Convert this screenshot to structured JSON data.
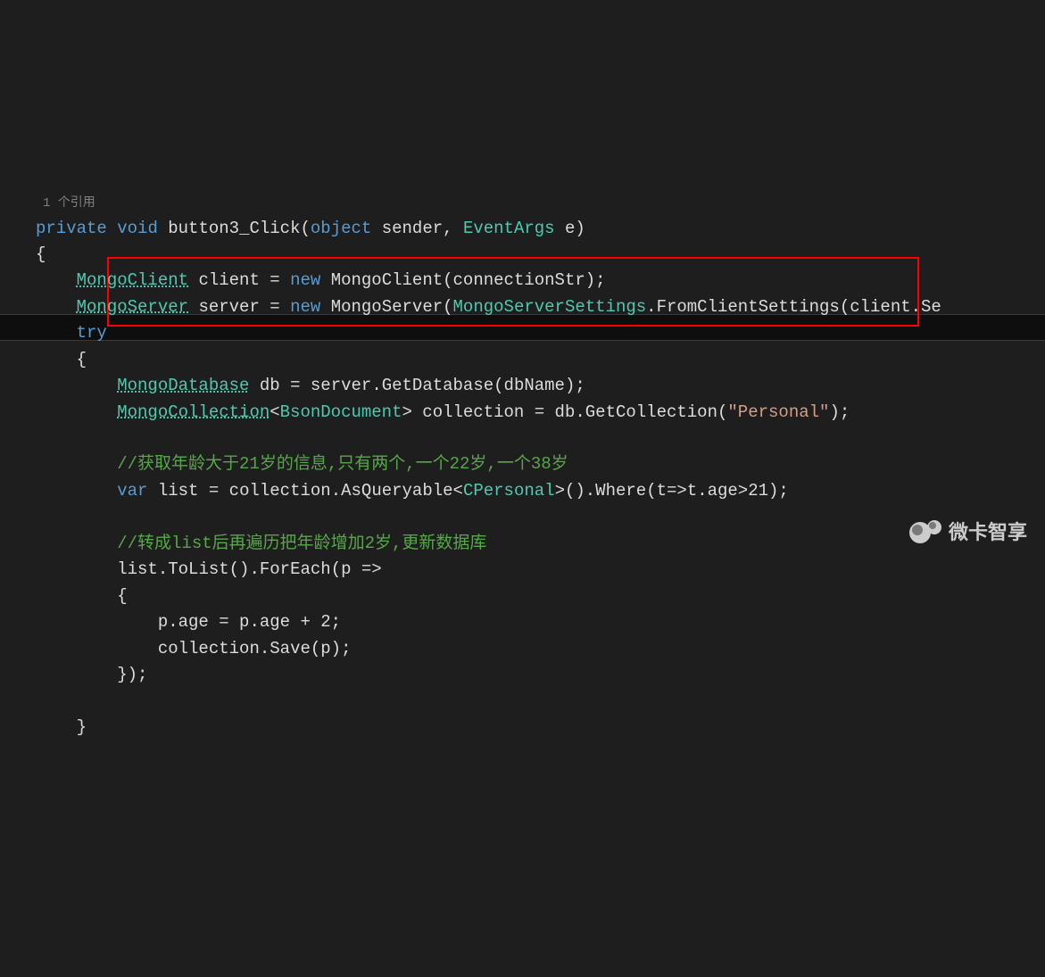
{
  "refs": "1 个引用",
  "code": {
    "kw_private": "private",
    "kw_void": "void",
    "method": "button3_Click",
    "kw_object": "object",
    "p_sender": "sender",
    "type_eventargs": "EventArgs",
    "p_e": "e",
    "type_mongoclient": "MongoClient",
    "v_client": "client",
    "kw_new1": "new",
    "ctor_mongoclient": "MongoClient",
    "p_conn": "connectionStr",
    "type_mongoserver": "MongoServer",
    "v_server": "server",
    "kw_new2": "new",
    "ctor_mongoserver": "MongoServer",
    "type_mss": "MongoServerSettings",
    "m_fromclient": "FromClientSettings",
    "p_clientSe": "client.Se",
    "kw_try": "try",
    "type_mongodb": "MongoDatabase",
    "v_db": "db",
    "v_server2": "server",
    "m_getdb": "GetDatabase",
    "p_dbname": "dbName",
    "type_mongocoll": "MongoCollection",
    "type_bsondoc": "BsonDocument",
    "v_coll": "collection",
    "v_db2": "db",
    "m_getcoll": "GetCollection",
    "str_personal": "\"Personal\"",
    "cmt1": "//获取年龄大于21岁的信息,只有两个,一个22岁,一个38岁",
    "kw_var": "var",
    "v_list": "list",
    "v_coll2": "collection",
    "m_asq": "AsQueryable",
    "type_cpersonal": "CPersonal",
    "m_where": "Where",
    "lambda_where": "(t=>t.age>21)",
    "cmt2": "//转成list后再遍历把年龄增加2岁,更新数据库",
    "v_list2": "list",
    "m_tolist": "ToList",
    "m_foreach": "ForEach",
    "p_lambda": "(p =>",
    "stmt_age": "p.age = p.age + 2;",
    "v_coll3": "collection",
    "m_save": "Save",
    "p_p": "(p)",
    "close_lambda": "});"
  },
  "watermark": "微卡智享"
}
